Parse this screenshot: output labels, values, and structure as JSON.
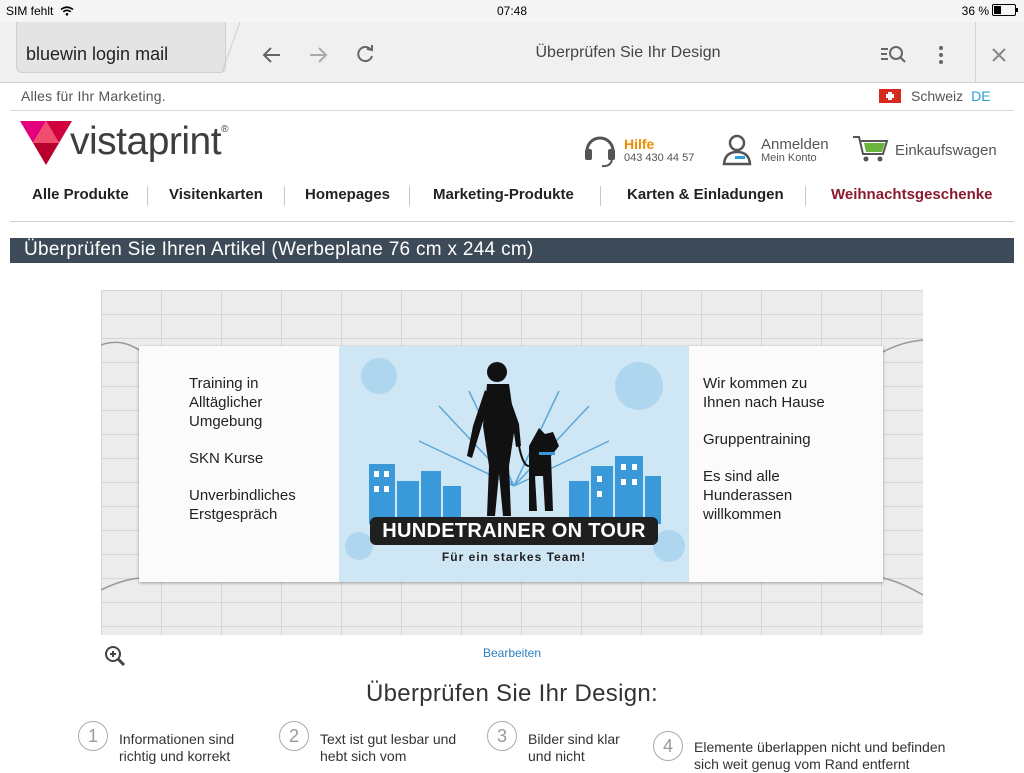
{
  "status": {
    "carrier": "SIM fehlt",
    "time": "07:48",
    "battery": "36 %"
  },
  "browser": {
    "url_text": "bluewin login mail",
    "page_title": "Überprüfen Sie Ihr Design",
    "icons": [
      "back-icon",
      "forward-icon",
      "reload-icon",
      "find-icon",
      "more-icon",
      "close-icon"
    ]
  },
  "site": {
    "tagline": "Alles für Ihr Marketing.",
    "country": "Schweiz",
    "language": "DE",
    "logo": "vistaprint",
    "help": {
      "title": "Hilfe",
      "phone": "043 430 44 57"
    },
    "login": {
      "title": "Anmelden",
      "subtitle": "Mein Konto"
    },
    "cart": "Einkaufswagen",
    "nav": [
      "Alle Produkte",
      "Visitenkarten",
      "Homepages",
      "Marketing-Produkte",
      "Karten & Einladungen",
      "Weihnachtsgeschenke"
    ],
    "colors": {
      "accent": "#2a9fd6",
      "brand_red": "#c4003b",
      "help_orange": "#f08c00",
      "section_bar": "#3d4a57",
      "nav_highlight": "#8b1a2e"
    }
  },
  "review": {
    "section_title": "Überprüfen Sie Ihren Artikel (Werbeplane 76 cm x 244 cm)",
    "banner": {
      "left": [
        "Training in",
        "Alltäglicher",
        "Umgebung",
        "",
        "SKN Kurse",
        "",
        "Unverbindliches",
        "Erstgespräch"
      ],
      "right": [
        "Wir kommen zu",
        "Ihnen nach Hause",
        "",
        "Gruppentraining",
        "",
        "Es sind alle",
        "Hunderassen",
        "willkommen"
      ],
      "title": "HUNDETRAINER ON TOUR",
      "subtitle": "Für ein starkes Team!"
    },
    "edit_link": "Bearbeiten",
    "design_title": "Überprüfen Sie Ihr Design:",
    "checks": [
      {
        "num": "1",
        "text": "Informationen sind richtig und korrekt"
      },
      {
        "num": "2",
        "text": "Text ist gut lesbar und hebt sich vom"
      },
      {
        "num": "3",
        "text": "Bilder sind klar und nicht"
      },
      {
        "num": "4",
        "text": "Elemente überlappen nicht und befinden sich weit genug vom Rand entfernt"
      }
    ]
  }
}
